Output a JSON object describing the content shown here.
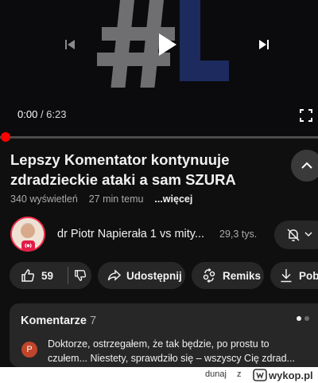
{
  "player": {
    "current_time": "0:00",
    "duration": "6:23",
    "progress_fraction": 0.0,
    "colors": {
      "progress": "#ff0000",
      "track": "#4b4b4b"
    }
  },
  "video": {
    "title": "Lepszy Komentator kontynuuje zdradzieckie ataki a sam SZURA",
    "views": "340 wyświetleń",
    "age": "27 min temu",
    "more_label": "...więcej"
  },
  "channel": {
    "name": "dr Piotr Napierała 1 vs mity...",
    "subscribers": "29,3 tys.",
    "avatar_icon": "avatar-portrait",
    "live_badge_icon": "broadcast-icon"
  },
  "actions": {
    "like_count": "59",
    "share_label": "Udostępnij",
    "remix_label": "Remiks",
    "download_label": "Pob"
  },
  "comments": {
    "heading": "Komentarze",
    "count": "7",
    "top_comment": {
      "avatar_letter": "P",
      "line1": "Doktorze, ostrzegałem, że tak będzie, po prostu to",
      "line2": "czułem... Niestety, sprawdziło się – wszyscy Cię zdrad..."
    }
  },
  "watermark": {
    "user": "dunaj",
    "sep": "z",
    "site": "wykop.pl"
  },
  "colors": {
    "background": "#0f0f0f",
    "chip": "#272727",
    "accent_red": "#ff0000",
    "text_secondary": "#aaaaaa"
  }
}
